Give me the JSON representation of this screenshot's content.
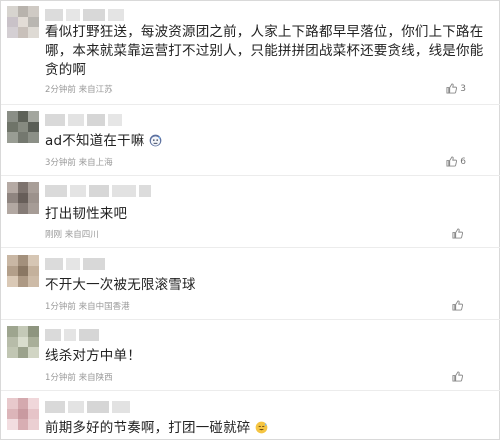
{
  "comments": [
    {
      "text": "看似打野狂送，每波资源团之前，人家上下路都早早落位，你们上下路在哪，本来就菜靠运营打不过别人，只能拼拼团战菜杯还要贪线，线是你能贪的啊",
      "time": "2分钟前",
      "source": "来自江苏",
      "likes": "3"
    },
    {
      "text": "ad不知道在干嘛",
      "emoji": "sweat-face",
      "time": "3分钟前",
      "source": "来自上海",
      "likes": "6"
    },
    {
      "text": "打出韧性来吧",
      "time": "刚刚",
      "source": "来自四川",
      "likes": ""
    },
    {
      "text": "不开大一次被无限滚雪球",
      "time": "1分钟前",
      "source": "来自中国香港",
      "likes": ""
    },
    {
      "text": "线杀对方中单！",
      "time": "1分钟前",
      "source": "来自陕西",
      "likes": ""
    },
    {
      "text": "前期多好的节奏啊，打团一碰就碎",
      "emoji": "sweat-smile-face",
      "time": "",
      "source": "",
      "likes": ""
    }
  ],
  "colors": {
    "like_icon": "#888888",
    "meta_text": "#9a9a9a"
  }
}
